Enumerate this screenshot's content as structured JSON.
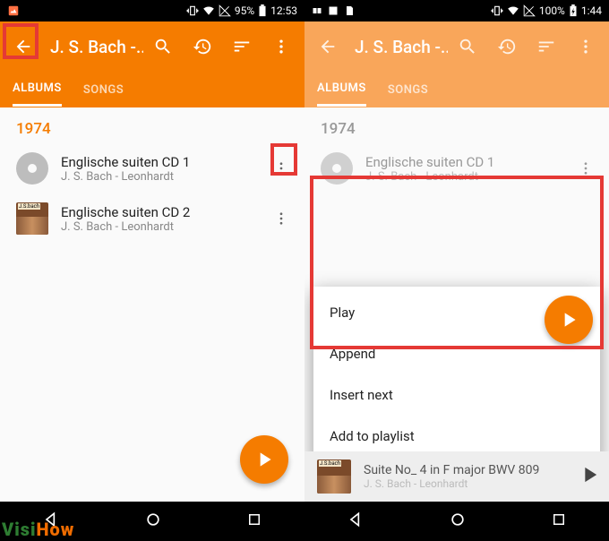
{
  "left": {
    "status": {
      "battery": "95%",
      "time": "12:53"
    },
    "title": "J. S. Bach -...",
    "tabs": {
      "albums": "ALBUMS",
      "songs": "SONGS"
    },
    "year": "1974",
    "albums": [
      {
        "title": "Englische suiten CD 1",
        "artist": "J. S. Bach - Leonhardt"
      },
      {
        "title": "Englische suiten CD 2",
        "artist": "J. S. Bach - Leonhardt"
      }
    ]
  },
  "right": {
    "status": {
      "battery": "100%",
      "time": "1:44"
    },
    "title": "J. S. Bach -...",
    "tabs": {
      "albums": "ALBUMS",
      "songs": "SONGS"
    },
    "year": "1974",
    "albums": [
      {
        "title": "Englische suiten CD 1",
        "artist": "J. S. Bach - Leonhardt"
      }
    ],
    "menu": {
      "play": "Play",
      "append": "Append",
      "insert": "Insert next",
      "addpl": "Add to playlist"
    },
    "nowplaying": {
      "title": "Suite No_ 4 in F major BWV 809",
      "artist": "J. S. Bach - Leonhardt"
    }
  },
  "watermark": "VisiHow"
}
